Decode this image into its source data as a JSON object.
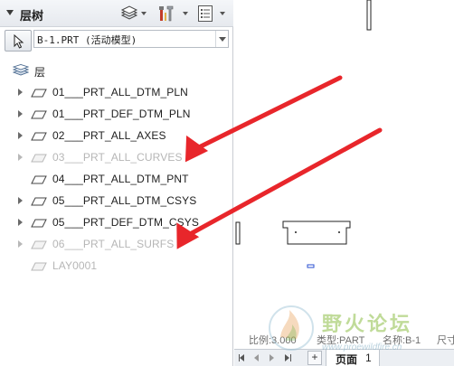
{
  "panel": {
    "title": "层树",
    "model_select": {
      "value": "B-1.PRT (活动模型)"
    }
  },
  "tree": {
    "root_label": "层",
    "items": [
      {
        "label": "01___PRT_ALL_DTM_PLN",
        "hidden": false,
        "expandable": true
      },
      {
        "label": "01___PRT_DEF_DTM_PLN",
        "hidden": false,
        "expandable": true
      },
      {
        "label": "02___PRT_ALL_AXES",
        "hidden": false,
        "expandable": true
      },
      {
        "label": "03___PRT_ALL_CURVES",
        "hidden": true,
        "expandable": true
      },
      {
        "label": "04___PRT_ALL_DTM_PNT",
        "hidden": false,
        "expandable": false
      },
      {
        "label": "05___PRT_ALL_DTM_CSYS",
        "hidden": false,
        "expandable": true
      },
      {
        "label": "05___PRT_DEF_DTM_CSYS",
        "hidden": false,
        "expandable": true
      },
      {
        "label": "06___PRT_ALL_SURFS",
        "hidden": true,
        "expandable": true
      },
      {
        "label": "LAY0001",
        "hidden": true,
        "expandable": false
      }
    ]
  },
  "status": {
    "scale": "比例:3.000",
    "type": "类型:PART",
    "name": "名称:B-1",
    "size": "尺寸"
  },
  "tabs": {
    "add_label": "+",
    "page_label": "页面",
    "page_number": "1"
  },
  "watermark": {
    "text": "野火论坛",
    "url": "www.proewildfire.cn"
  },
  "colors": {
    "arrow": "#e8262b",
    "hidden_text": "#b6b6b6",
    "panel_border": "#c9cdd3"
  }
}
